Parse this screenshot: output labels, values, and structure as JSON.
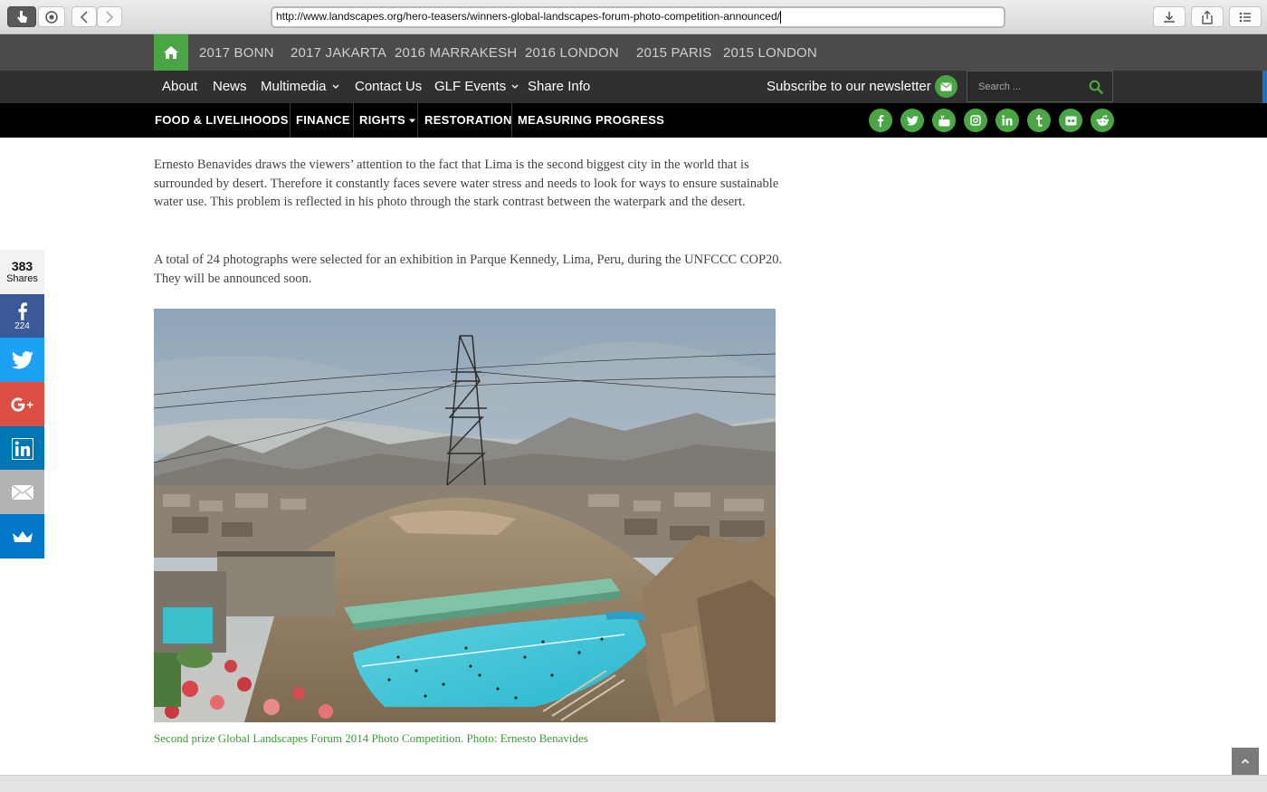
{
  "browser": {
    "url": "http://www.landscapes.org/hero-teasers/winners-global-landscapes-forum-photo-competition-announced/"
  },
  "year_nav": {
    "items": [
      "2017 BONN",
      "2017 JAKARTA",
      "2016 MARRAKESH",
      "2016 LONDON",
      "2015 PARIS",
      "2015 LONDON"
    ]
  },
  "main_nav": {
    "about": "About",
    "news": "News",
    "multimedia": "Multimedia",
    "contact": "Contact Us",
    "glf_events": "GLF Events",
    "share_info": "Share Info",
    "subscribe": "Subscribe to our newsletter",
    "search_placeholder": "Search ..."
  },
  "category_nav": {
    "food": "FOOD & LIVELIHOODS",
    "finance": "FINANCE",
    "rights": "RIGHTS",
    "restoration": "RESTORATION",
    "measuring": "MEASURING PROGRESS"
  },
  "social_icons": [
    "facebook-icon",
    "twitter-icon",
    "youtube-icon",
    "instagram-icon",
    "linkedin-icon",
    "tumblr-icon",
    "flickr-icon",
    "reddit-icon"
  ],
  "article": {
    "para1": "Ernesto Benavides draws the viewers’ attention to the fact that Lima is the second biggest city in the world that is surrounded by desert. Therefore it constantly faces severe water stress and needs to look for ways to ensure sustainable water use. This problem is reflected in his photo through the stark contrast between the waterpark and the desert.",
    "para2": "A total of 24 photographs were selected for an exhibition in Parque Kennedy, Lima, Peru, during the UNFCCC COP20. They will be announced soon.",
    "caption": "Second prize Global Landscapes Forum 2014 Photo Competition. Photo: Ernesto Benavides"
  },
  "share": {
    "total": "383",
    "label": "Shares",
    "facebook_count": "224"
  },
  "colors": {
    "green": "#4aa644",
    "facebook": "#3b5998",
    "twitter": "#1da1f2",
    "google": "#dc4e41",
    "linkedin": "#0077b5",
    "email": "#b3b3b3",
    "sumo": "#0077c9"
  }
}
